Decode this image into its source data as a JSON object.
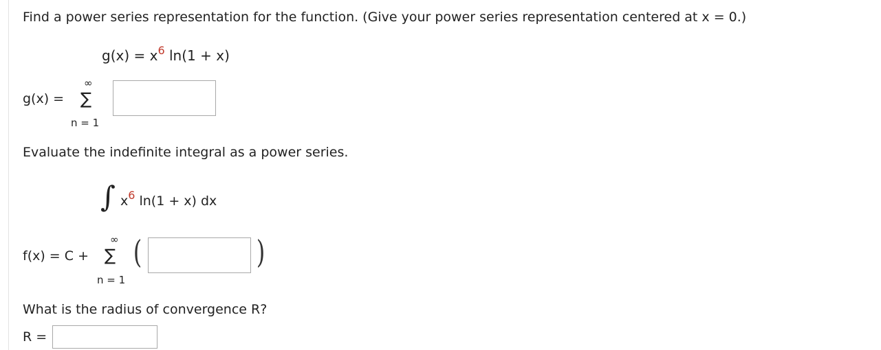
{
  "problem": {
    "intro": "Find a power series representation for the function. (Give your power series representation centered at x = 0.)",
    "function": {
      "lhs": "g(x) = x",
      "exp": "6",
      "rhs": " ln(1 + x)"
    }
  },
  "series1": {
    "lhs": "g(x)  =",
    "sigma": "∑",
    "upper": "∞",
    "lower": "n = 1"
  },
  "integral_prompt": "Evaluate the indefinite integral as a power series.",
  "integral": {
    "symbol": "∫",
    "base": "x",
    "exp": "6",
    "rest": " ln(1 + x) dx"
  },
  "series2": {
    "lhs": "f(x) = C +",
    "sigma": "∑",
    "upper": "∞",
    "lower": "n = 1",
    "lparen": "(",
    "rparen": ")"
  },
  "radius": {
    "question": "What is the radius of convergence R?",
    "label": "R ="
  },
  "answers": {
    "series1_value": "",
    "series2_value": "",
    "radius_value": ""
  }
}
